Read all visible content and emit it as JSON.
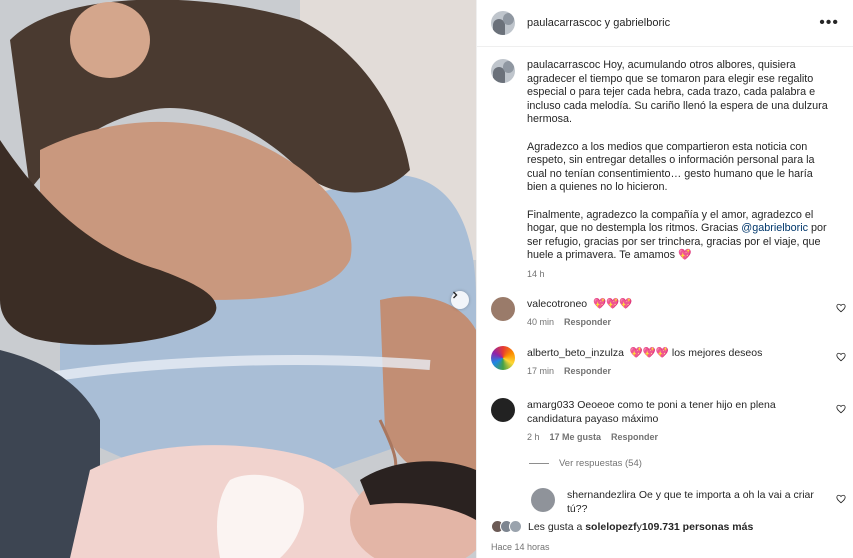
{
  "post": {
    "header_user": "paulacarrascoc y gabrielboric",
    "caption_user": "paulacarrascoc",
    "caption_p1": "Hoy, acumulando otros albores, quisiera agradecer el tiempo que se tomaron para elegir ese regalito especial o para tejer cada hebra, cada trazo, cada palabra e incluso cada melodía. Su cariño llenó la espera de una dulzura hermosa.",
    "caption_p2": "Agradezco a los medios que compartieron esta noticia con respeto, sin entregar detalles o información personal para la cual no tenían consentimiento… gesto humano que le haría bien a quienes no lo hicieron.",
    "caption_p3_pre": "Finalmente, agradezco la compañía y el amor, agradezco el hogar, que no destempla los ritmos. Gracias ",
    "caption_mention": "@gabrielboric",
    "caption_p3_post": " por ser refugio, gracias por ser trinchera, gracias por el viaje, que huele a primavera. Te amamos 💖",
    "caption_time": "14 h"
  },
  "comments": [
    {
      "user": "valecotroneo",
      "text": "💖💖💖",
      "time": "40 min",
      "likes": "",
      "reply": "Responder"
    },
    {
      "user": "alberto_beto_inzulza",
      "text": "💖💖💖 los mejores deseos",
      "time": "17 min",
      "likes": "",
      "reply": "Responder"
    },
    {
      "user": "amarg033",
      "text": "Oeoeoe como te poni a tener hijo en plena candidatura payaso máximo",
      "time": "2 h",
      "likes": "17 Me gusta",
      "reply": "Responder"
    }
  ],
  "view_replies": "Ver respuestas (54)",
  "reply_comment": {
    "user": "shernandezlira",
    "text": "Oe y que te importa a oh la vai a criar tú??"
  },
  "footer": {
    "likes_prefix": "Les gusta a ",
    "likes_user": "solelopezf",
    "likes_mid": " y ",
    "likes_count": "109.731 personas más",
    "time": "Hace 14 horas"
  },
  "colors": {
    "link": "#00376b",
    "muted": "#737373",
    "heart": "#e0245e"
  },
  "icons": [
    "more-options-icon",
    "next-arrow-icon",
    "heart-outline-icon"
  ]
}
